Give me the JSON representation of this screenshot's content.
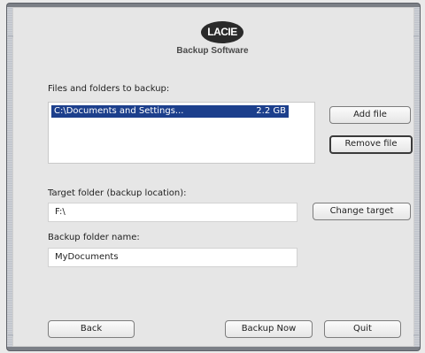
{
  "brand": {
    "logo_text": "LACIE",
    "product": "Backup Software"
  },
  "files": {
    "label": "Files and folders to backup:",
    "items": [
      {
        "path": "C:\\Documents and Settings...",
        "size": "2.2 GB",
        "selected": true
      }
    ],
    "add_label": "Add file",
    "remove_label": "Remove file"
  },
  "target": {
    "label": "Target folder (backup location):",
    "value": "F:\\",
    "change_label": "Change target"
  },
  "folder_name": {
    "label": "Backup folder name:",
    "value": "MyDocuments"
  },
  "footer": {
    "back_label": "Back",
    "backup_now_label": "Backup Now",
    "quit_label": "Quit"
  },
  "colors": {
    "selection": "#1c3f8c",
    "frame": "#7b7f86",
    "panel": "#e6e6e6"
  }
}
